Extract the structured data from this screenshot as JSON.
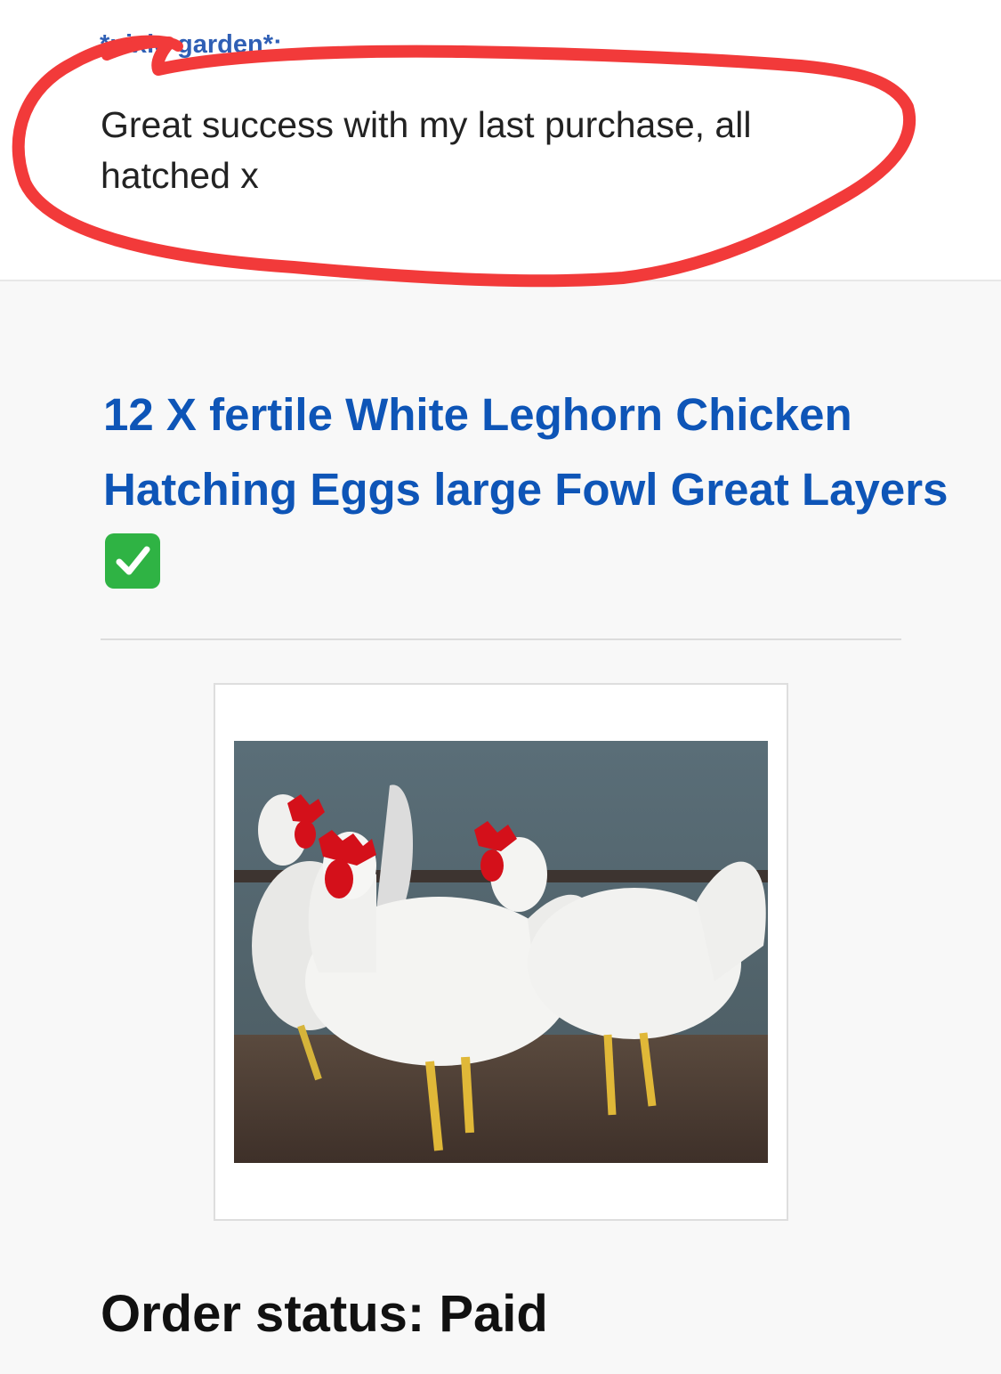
{
  "review": {
    "username": "*pixie-garden*:",
    "message": "Great success with my last purchase, all hatched x"
  },
  "item": {
    "title": "12 X fertile White Leghorn Chicken Hatching Eggs large Fowl Great Layers",
    "title_badge_icon": "check-mark-button-icon",
    "image_subject": "three white leghorn chickens"
  },
  "order": {
    "status": "Order status: Paid"
  },
  "colors": {
    "title_link": "#0e55b7",
    "username": "#2f5fb5",
    "annotation_circle": "#f23a3a",
    "badge": "#2fb344"
  }
}
